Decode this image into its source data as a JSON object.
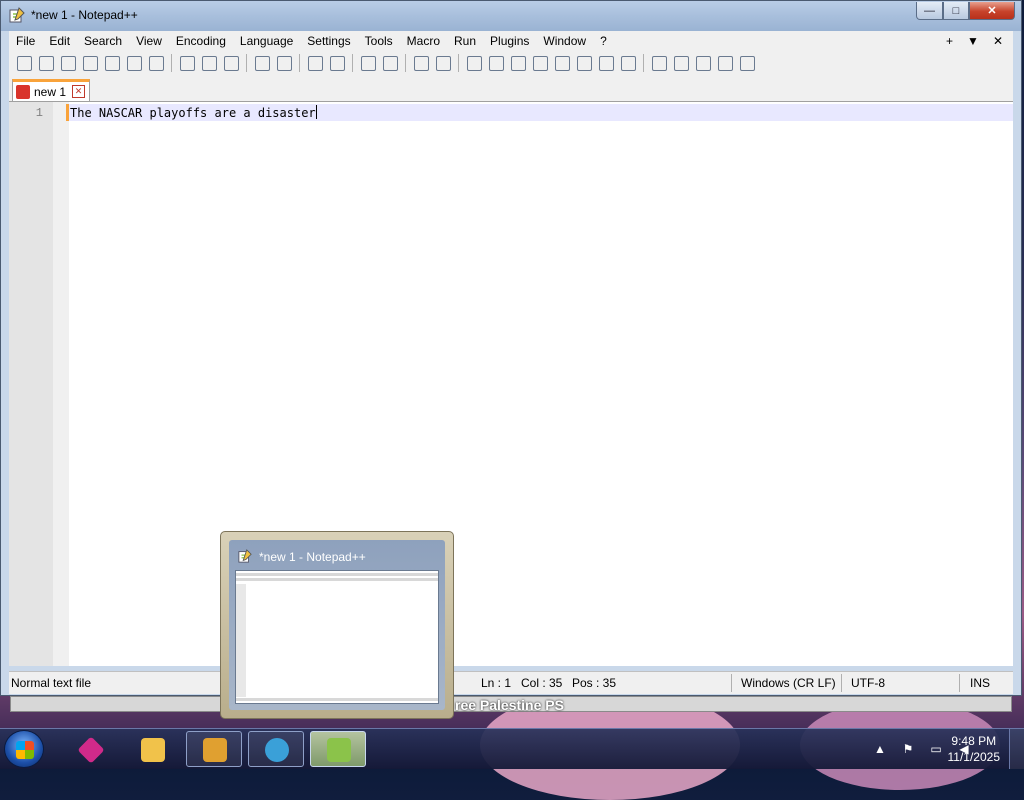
{
  "window": {
    "title": "*new 1 - Notepad++",
    "controls": {
      "minimize": "—",
      "maximize": "□",
      "close": "✕"
    }
  },
  "menubar": {
    "items": [
      "File",
      "Edit",
      "Search",
      "View",
      "Encoding",
      "Language",
      "Settings",
      "Tools",
      "Macro",
      "Run",
      "Plugins",
      "Window",
      "?"
    ],
    "right": [
      "+",
      "▼",
      "✕"
    ]
  },
  "toolbar": {
    "icons": [
      "new-file-icon",
      "open-file-icon",
      "save-icon",
      "save-all-icon",
      "close-icon",
      "close-all-icon",
      "print-icon",
      "cut-icon",
      "copy-icon",
      "paste-icon",
      "undo-icon",
      "redo-icon",
      "find-icon",
      "replace-icon",
      "zoom-in-icon",
      "zoom-out-icon",
      "sync-vertical-icon",
      "sync-horizontal-icon",
      "word-wrap-icon",
      "show-all-chars-icon",
      "indent-guide-icon",
      "user-language-icon",
      "doc-map-icon",
      "function-list-icon",
      "folder-workspace-icon",
      "monitoring-icon",
      "record-macro-icon",
      "stop-macro-icon",
      "play-macro-icon",
      "run-macro-multiple-icon",
      "save-macro-icon"
    ]
  },
  "tabs": [
    {
      "label": "new 1",
      "modified": true,
      "active": true
    }
  ],
  "editor": {
    "lines": [
      {
        "number": "1",
        "text": "The NASCAR playoffs are a disaster"
      }
    ]
  },
  "statusbar": {
    "filetype": "Normal text file",
    "ln": "Ln : 1",
    "col": "Col : 35",
    "pos": "Pos : 35",
    "eol": "Windows (CR LF)",
    "encoding": "UTF-8",
    "mode": "INS"
  },
  "preview": {
    "title": "*new 1 - Notepad++"
  },
  "background": {
    "text": "ree Palestine PS"
  },
  "taskbar": {
    "buttons": [
      {
        "name": "start-button"
      },
      {
        "name": "taskbar-app-pink-cube",
        "color": "#d02a8a"
      },
      {
        "name": "taskbar-app-explorer",
        "color": "#f1c24a"
      },
      {
        "name": "taskbar-app-vlc",
        "color": "#7a7a7a"
      },
      {
        "name": "taskbar-app-browser",
        "color": "#3aa0d8"
      },
      {
        "name": "taskbar-app-notepadpp",
        "color": "#8bc34a"
      }
    ],
    "clock": {
      "time": "9:48 PM",
      "date": "11/1/2025"
    }
  }
}
